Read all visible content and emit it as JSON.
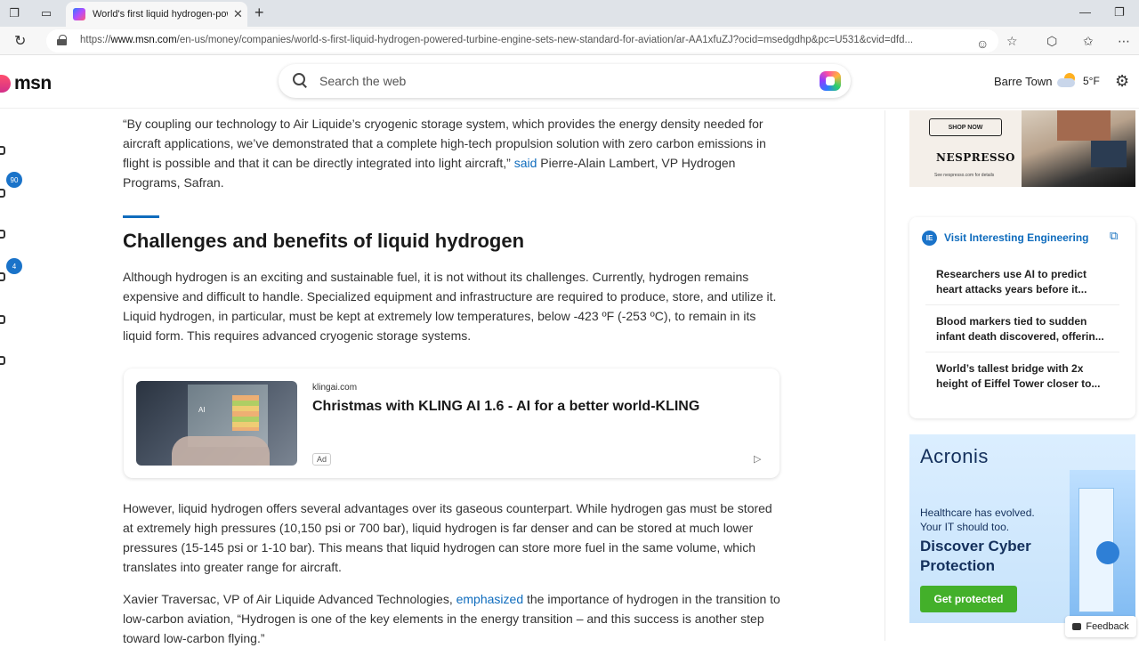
{
  "browser": {
    "tab_title": "World's first liquid hydrogen-pow",
    "url_prefix": "https://",
    "url_host": "www.msn.com",
    "url_path": "/en-us/money/companies/world-s-first-liquid-hydrogen-powered-turbine-engine-sets-new-standard-for-aviation/ar-AA1xfuZJ?ocid=msedgdhp&pc=U531&cvid=dfd..."
  },
  "header": {
    "logo": "msn",
    "search_placeholder": "Search the web",
    "weather_location": "Barre Town",
    "weather_temp": "5°F"
  },
  "left_rail": {
    "badge_1": "90",
    "badge_2": "4"
  },
  "article": {
    "quote_text": "“By coupling our technology to Air Liquide’s cryogenic storage system, which provides the energy density needed for aircraft applications, we’ve demonstrated that a complete high-tech propulsion solution with zero carbon emissions in flight is possible and that it can be directly integrated into light aircraft,”",
    "quote_link": "said",
    "quote_attrib": " Pierre-Alain Lambert, VP Hydrogen Programs, Safran.",
    "heading": "Challenges and benefits of liquid hydrogen",
    "para_challenges": "Although hydrogen is an exciting and sustainable fuel, it is not without its challenges. Currently, hydrogen remains expensive and difficult to handle. Specialized equipment and infrastructure are required to produce, store, and utilize it. Liquid hydrogen, in particular, must be kept at extremely low temperatures, below -423 ºF (-253 ºC), to remain in its liquid form. This requires advanced cryogenic storage systems.",
    "para_advantages": "However, liquid hydrogen offers several advantages over its gaseous counterpart. While hydrogen gas must be stored at extremely high pressures (10,150 psi or 700 bar), liquid hydrogen is far denser and can be stored at much lower pressures (15-145 psi or 1-10 bar). This means that liquid hydrogen can store more fuel in the same volume, which translates into greater range for aircraft.",
    "para_xavier_start": "Xavier Traversac, VP of Air Liquide Advanced Technologies, ",
    "para_xavier_link": "emphasized",
    "para_xavier_end": " the importance of hydrogen in the transition to low-carbon aviation, “Hydrogen is one of the key elements in the energy transition – and this success is another step toward low-carbon flying.”"
  },
  "ad": {
    "source": "klingai.com",
    "title": "Christmas with KLING AI 1.6 - AI for a better world-KLING",
    "badge": "Ad",
    "thumb_label": "AI"
  },
  "sidebar": {
    "nespresso": {
      "shop_label": "SHOP NOW",
      "brand": "NESPRESSO",
      "small": "See nespresso.com for details"
    },
    "ie": {
      "logo": "IE",
      "title": "Visit Interesting Engineering",
      "items": [
        "Researchers use AI to predict heart attacks years before it...",
        "Blood markers tied to sudden infant death discovered, offerin...",
        "World’s tallest bridge with 2x height of Eiffel Tower closer to..."
      ]
    },
    "acronis": {
      "logo": "Acronis",
      "sub": "Healthcare has evolved. Your IT should too.",
      "headline": "Discover Cyber Protection",
      "button": "Get protected"
    }
  },
  "feedback": "Feedback"
}
